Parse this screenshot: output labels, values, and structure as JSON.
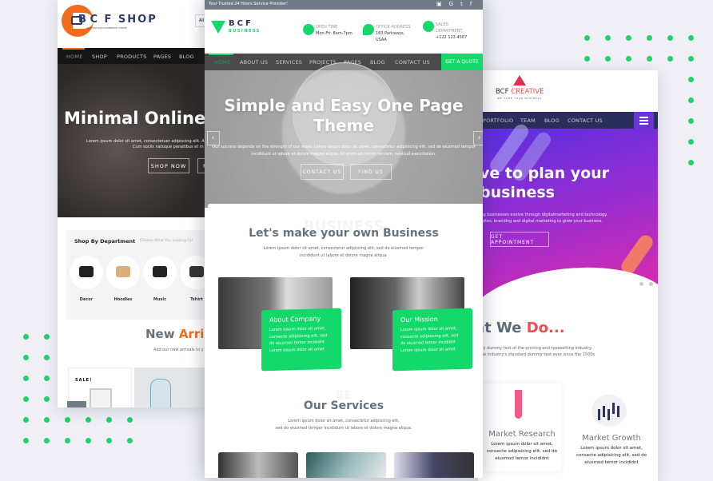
{
  "colors": {
    "green": "#12d96a",
    "orange": "#f26b1d",
    "navy": "#2b2d5c",
    "purple": "#6a32d8",
    "magenta": "#d12bb0",
    "coral": "#f04e4e"
  },
  "shop": {
    "logo": "C F SHOP",
    "logo_prefix": "B",
    "tagline": "CUSTOM WOOCOMMERCE THEME",
    "search_hint": "All",
    "nav": [
      "HOME",
      "SHOP",
      "PRODUCTS",
      "PAGES",
      "BLOG"
    ],
    "hero_title": "Minimal Online",
    "hero_text": [
      "Lorem ipsum dolor sit amet, consectetuer adipiscing elit. A",
      "Cum sociis natoque penatibus et m"
    ],
    "buttons": [
      "SHOP NOW",
      "N"
    ],
    "dept_title": "Shop By Department",
    "dept_sub": "Choose What You Looking For",
    "departments": [
      {
        "label": "Decor",
        "icon": "camera-icon"
      },
      {
        "label": "Hoodies",
        "icon": "hat-icon"
      },
      {
        "label": "Music",
        "icon": "headphones-icon"
      },
      {
        "label": "Tshirt",
        "icon": "bag-icon"
      }
    ],
    "arrivals_a": "New",
    "arrivals_b": "Arriv",
    "arrivals_text": "Add our new arrivals to y",
    "sale": "SALE!"
  },
  "business": {
    "topbar": "Your Trusted 24 Hoors Service Provider!",
    "social": [
      "youtube-icon",
      "google-icon",
      "twitter-icon",
      "facebook-icon"
    ],
    "logo": "BCF",
    "logo_sub": "BUSINESS",
    "info": [
      {
        "icon": "clock-icon",
        "title": "OPEN TIME",
        "lines": [
          "Mon-Fri: 8am-7pm"
        ]
      },
      {
        "icon": "map-pin-icon",
        "title": "OFFICE ADDRESS",
        "lines": [
          "183 Parkways,",
          "USAA"
        ]
      },
      {
        "icon": "phone-icon",
        "title": "SALES DEPARTMENT",
        "lines": [
          "+122 123 4567"
        ]
      }
    ],
    "nav": [
      "HOME",
      "ABOUT US",
      "SERVICES",
      "PROJECTS",
      "PAGES",
      "BLOG",
      "CONTACT US"
    ],
    "quote": "GET A QUOTE",
    "hero_title": [
      "Simple and Easy One Page",
      "Theme"
    ],
    "hero_text": [
      "Our success depends on the strength of our team. Lorem ipsum dolor sit amet, consectetur adipisicing elit, sed do eiusmod tempor",
      "incididunt ut labore et dolore magna aliqua. Ut enim ad minim veniam, nostrud exercitation."
    ],
    "hero_buttons": [
      "CONTACT US",
      "FIND US"
    ],
    "watermark": "BUSINESS",
    "section_title": "Let's make your own Business",
    "section_text": [
      "Lorem ipsum dolor sit amet, consectetur adipiscing elit, sed do eiusmod tempor",
      "incididunt ut labore et dolore magna aliqua."
    ],
    "cards": [
      {
        "title": "About Company",
        "lines": [
          "Lorem ipsum dolor sit amet,",
          "consecte adipisicing elit, sed",
          "do eiusmod temor incididnt",
          "Lorem ipsum dolor sit amet"
        ]
      },
      {
        "title": "Our Mission",
        "lines": [
          "Lorem ipsum dolor sit amet,",
          "consecte adipisicing elit, sed",
          "do eiusmod temor incididnt",
          "Lorem ipsum dolor sit amet"
        ]
      }
    ],
    "services_watermark": "BE",
    "services_title": "Our Services",
    "services_text": [
      "Lorem ipsum dolor sit amet, consectetur adipiscing elit,",
      "sed do eiusmod tempor incididunt ut labore et dolore magna aliqua."
    ]
  },
  "creative": {
    "logo_a": "BCF",
    "logo_b": "CREATIVE",
    "tagline": "WE CARE YOUR BUSINESS",
    "nav": [
      "PORTFOLIO",
      "TEAM",
      "BLOG",
      "CONTACT US"
    ],
    "hero_title": [
      "ve to plan your",
      "business"
    ],
    "hero_text": [
      "ing businesses evolve through digitalmarketing and technology.",
      "bsites, branding and digital marketing to grow your business."
    ],
    "button": "GET APPOINTMENT",
    "what_a": "at We",
    "what_b": "Do...",
    "what_text": [
      "ply dummy text of the printing and typesetting industry.",
      "the industry's standard dummy text ever since the 1500s"
    ],
    "services": [
      {
        "title": "Market Research",
        "lines": [
          "Lorem ipsum dolor sit amet,",
          "consecte adipisicing elit, sed do",
          "eiusmod temor incididnt"
        ]
      },
      {
        "title": "Market Growth",
        "lines": [
          "Lorem ipsum dolor sit amet,",
          "consecte adipisicing elit, sed do",
          "eiusmod temor incididnt"
        ]
      }
    ]
  }
}
